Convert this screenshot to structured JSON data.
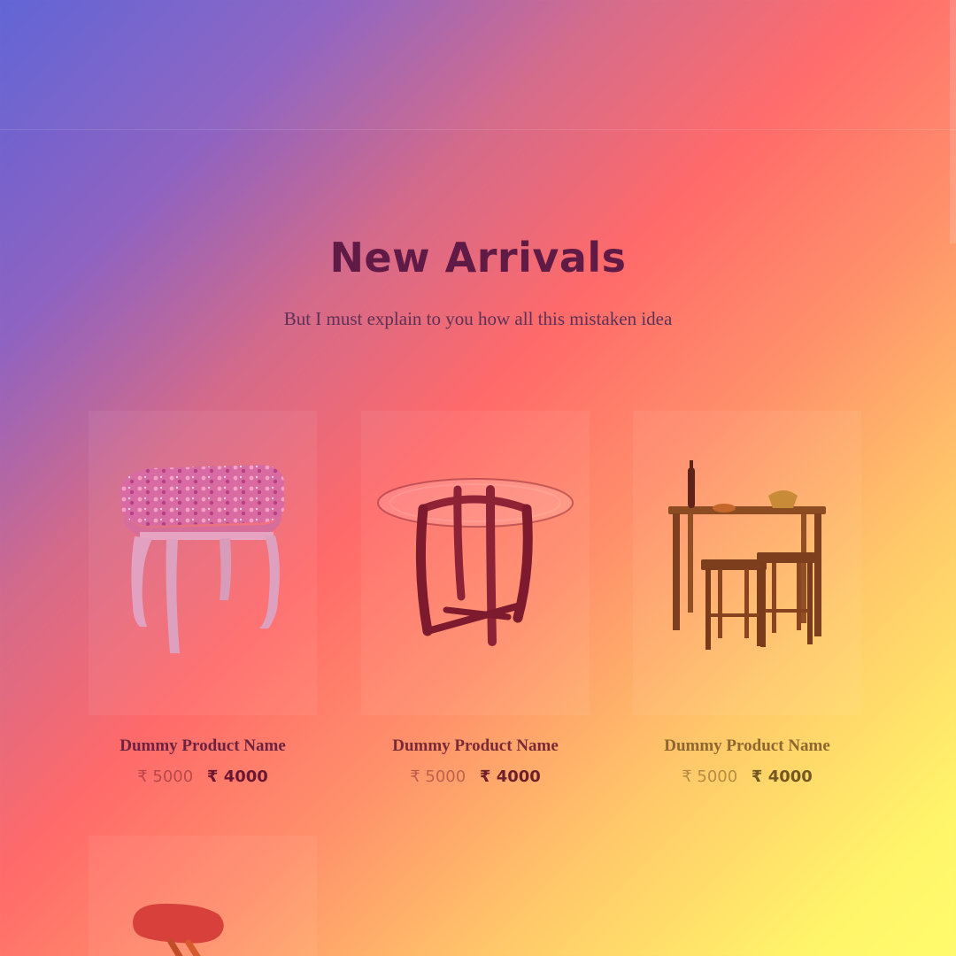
{
  "section": {
    "title": "New Arrivals",
    "subtitle": "But I must explain to you how all this mistaken idea"
  },
  "products": [
    {
      "name": "Dummy Product Name",
      "price_old": "₹ 5000",
      "price_new": "₹ 4000",
      "image": "floral-stool"
    },
    {
      "name": "Dummy Product Name",
      "price_old": "₹ 5000",
      "price_new": "₹ 4000",
      "image": "glass-table"
    },
    {
      "name": "Dummy Product Name",
      "price_old": "₹ 5000",
      "price_new": "₹ 4000",
      "image": "bar-table-set"
    },
    {
      "image": "red-stool"
    }
  ],
  "colors": {
    "title": "#5f1a45",
    "subtitle": "#5d3156",
    "gradient_start": "#5f62d6",
    "gradient_mid": "#ff6a6a",
    "gradient_end": "#fffb6d"
  }
}
